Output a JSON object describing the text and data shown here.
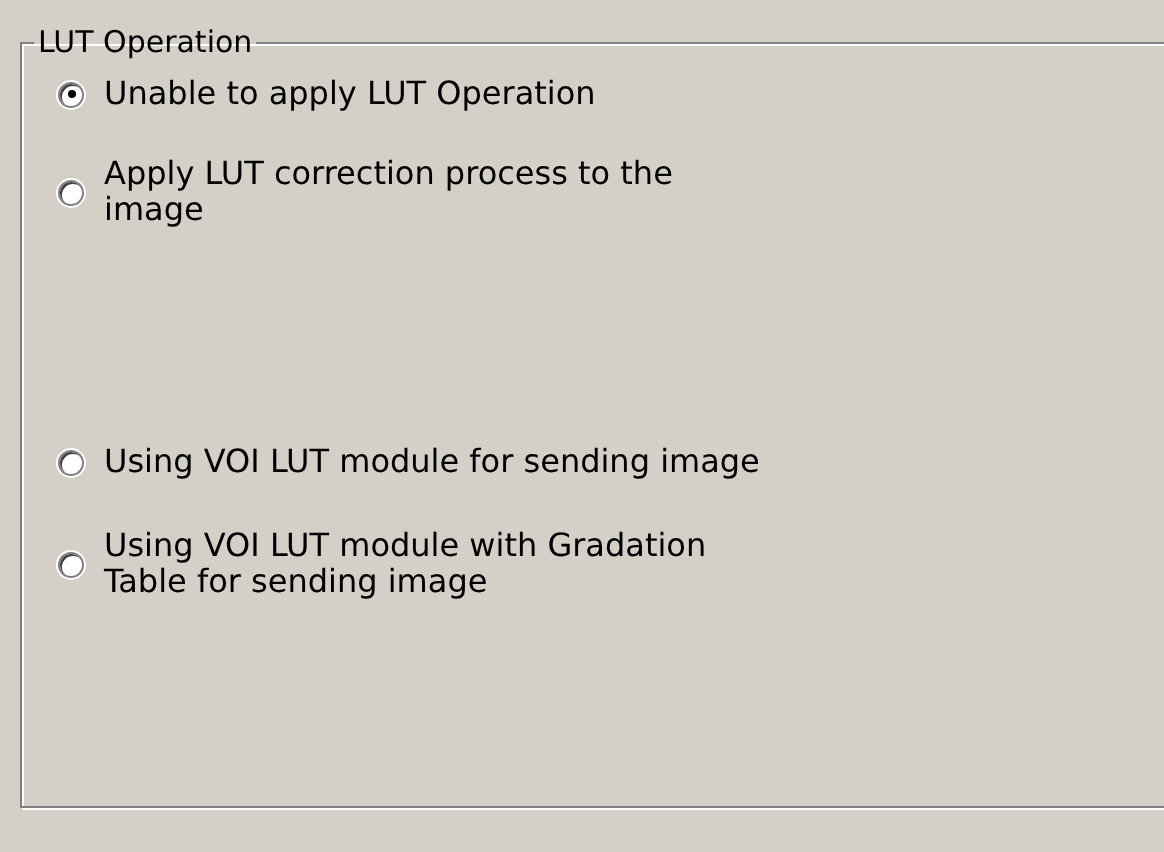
{
  "group": {
    "title": "LUT Operation",
    "options": [
      {
        "label": "Unable to apply LUT Operation",
        "selected": true
      },
      {
        "label": "Apply LUT correction process to the\nimage",
        "selected": false
      },
      {
        "label": "Using VOI LUT module for sending image",
        "selected": false
      },
      {
        "label": "Using VOI LUT module with Gradation\nTable for sending image",
        "selected": false
      }
    ]
  }
}
